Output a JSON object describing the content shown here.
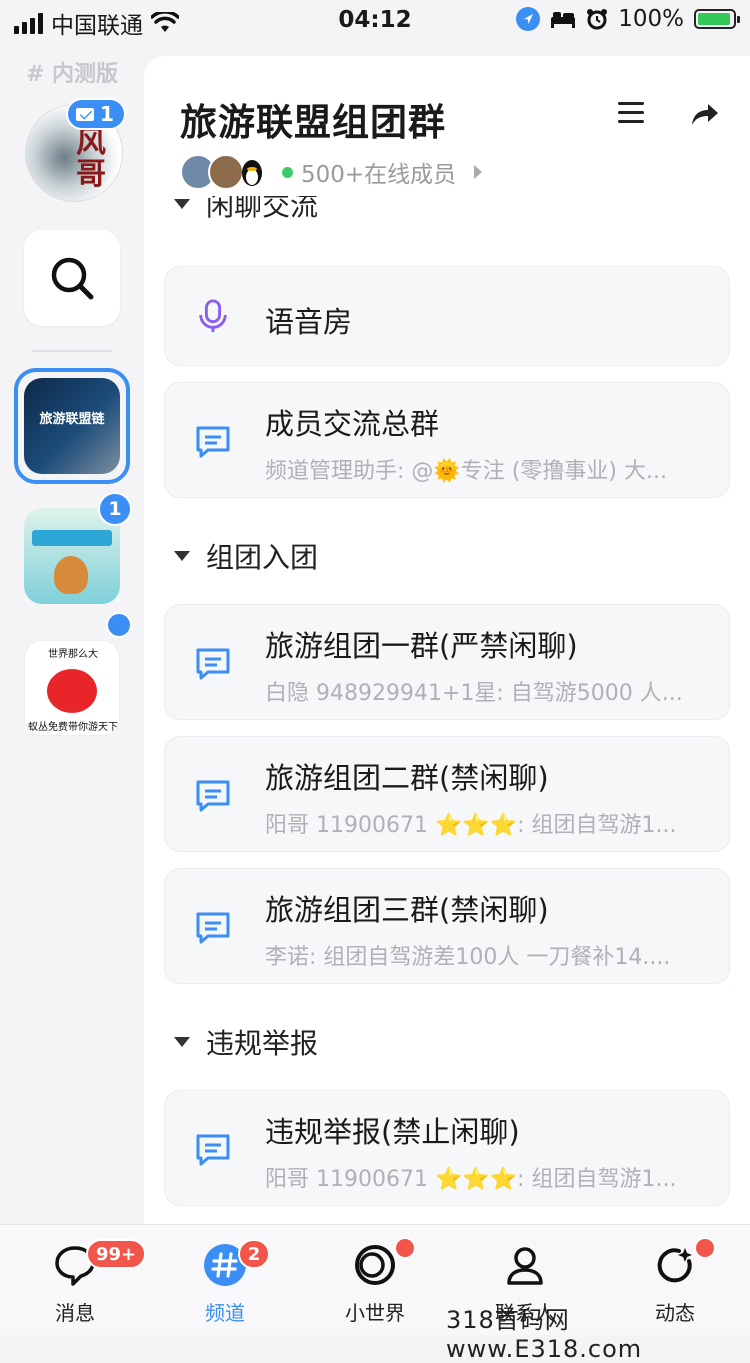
{
  "status_bar": {
    "carrier": "中国联通",
    "time": "04:12",
    "battery": "100%"
  },
  "rail": {
    "beta_label": "# 内测版",
    "profile_badge": "1",
    "guild1_text": "旅游联盟链",
    "guild2_badge": "1",
    "guild3_top": "世界那么大",
    "guild3_bottom": "蚁丛免费带你游天下"
  },
  "header": {
    "title": "旅游联盟组团群",
    "online": "500+在线成员"
  },
  "sections": [
    {
      "label": "闲聊交流",
      "channels": [
        {
          "type": "voice",
          "title": "语音房",
          "subtitle": ""
        },
        {
          "type": "text",
          "title": "成员交流总群",
          "subtitle": "频道管理助手: @🌞专注 (零撸事业) 大..."
        }
      ]
    },
    {
      "label": "组团入团",
      "channels": [
        {
          "type": "text",
          "title": "旅游组团一群(严禁闲聊)",
          "subtitle": "白隐 948929941+1星: 自驾游5000 人..."
        },
        {
          "type": "text",
          "title": "旅游组团二群(禁闲聊)",
          "subtitle": "阳哥 11900671 ⭐⭐⭐: 组团自驾游1..."
        },
        {
          "type": "text",
          "title": "旅游组团三群(禁闲聊)",
          "subtitle": "李诺: 组团自驾游差100人 一刀餐补14...."
        }
      ]
    },
    {
      "label": "违规举报",
      "channels": [
        {
          "type": "text",
          "title": "违规举报(禁止闲聊)",
          "subtitle": "阳哥 11900671 ⭐⭐⭐: 组团自驾游1..."
        }
      ]
    }
  ],
  "tabbar": {
    "tabs": [
      {
        "label": "消息",
        "badge": "99+"
      },
      {
        "label": "频道",
        "badge": "2"
      },
      {
        "label": "小世界",
        "badge": ""
      },
      {
        "label": "联系人",
        "badge": ""
      },
      {
        "label": "动态",
        "badge": ""
      }
    ],
    "accent": "#3b8ef3",
    "badge_color": "#f2564a"
  },
  "watermark": "318首码网 www.E318.com"
}
